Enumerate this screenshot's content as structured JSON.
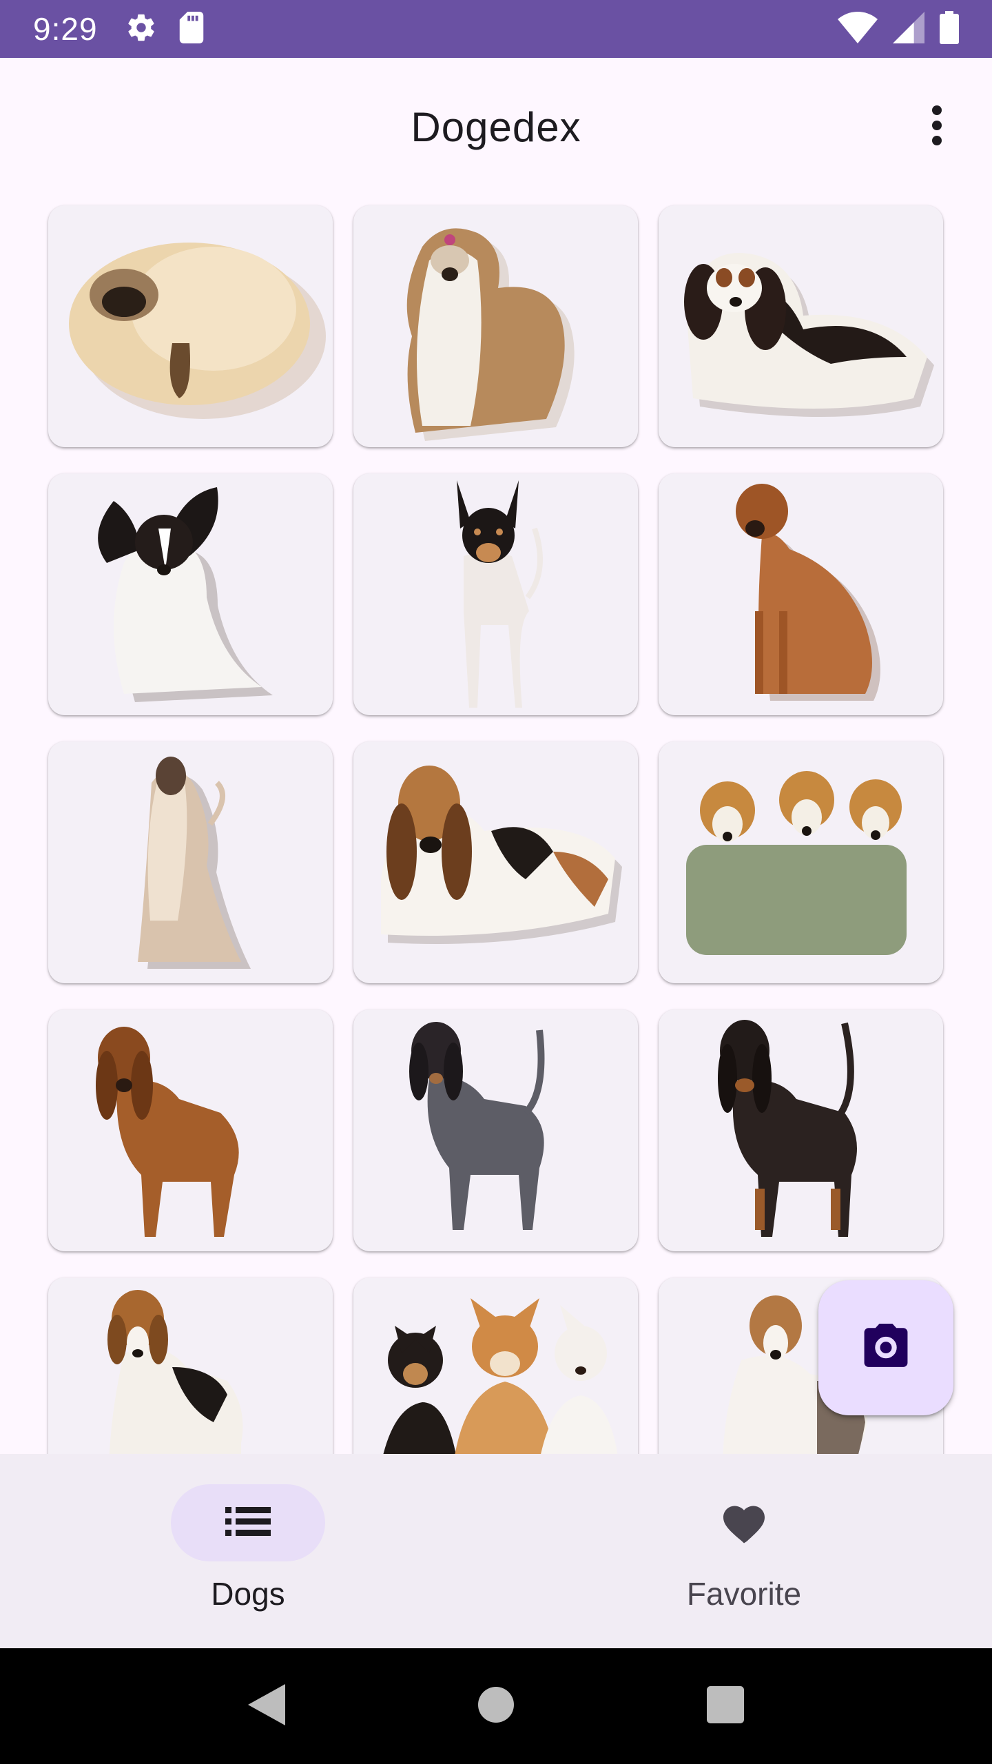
{
  "status_bar": {
    "time": "9:29",
    "left_icons": [
      "gear-icon",
      "sd-card-icon"
    ],
    "right_icons": [
      "wifi-icon",
      "signal-icon",
      "battery-icon"
    ]
  },
  "app_bar": {
    "title": "Dogedex",
    "overflow_icon": "more-vert-icon"
  },
  "grid": {
    "items": [
      {
        "breed_icon": "pekingese"
      },
      {
        "breed_icon": "shih-tzu"
      },
      {
        "breed_icon": "cavalier-king-charles"
      },
      {
        "breed_icon": "papillon"
      },
      {
        "breed_icon": "toy-fox-terrier"
      },
      {
        "breed_icon": "rhodesian-ridgeback"
      },
      {
        "breed_icon": "afghan-hound"
      },
      {
        "breed_icon": "basset-hound"
      },
      {
        "breed_icon": "beagle-group"
      },
      {
        "breed_icon": "bloodhound"
      },
      {
        "breed_icon": "bluetick-coonhound"
      },
      {
        "breed_icon": "black-and-tan-coonhound"
      },
      {
        "breed_icon": "treeing-walker-coonhound"
      },
      {
        "breed_icon": "chihuahua-group"
      },
      {
        "breed_icon": "english-foxhound"
      }
    ]
  },
  "fab": {
    "icon": "camera-icon"
  },
  "bottom_nav": {
    "items": [
      {
        "label": "Dogs",
        "icon": "list-icon",
        "selected": true
      },
      {
        "label": "Favorite",
        "icon": "heart-icon",
        "selected": false
      }
    ]
  },
  "system_nav": {
    "icons": [
      "back-icon",
      "home-icon",
      "recents-icon"
    ]
  },
  "colors": {
    "status_bar": "#6a51a3",
    "background": "#fef7ff",
    "card": "#f4f0f7",
    "fab": "#eaddff",
    "nav_bar": "#f1ecf4",
    "nav_indicator": "#e8def8"
  }
}
